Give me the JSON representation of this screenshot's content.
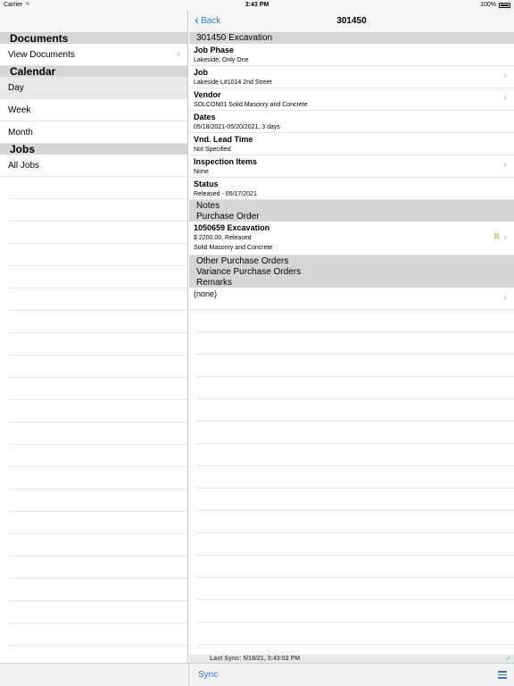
{
  "status_bar": {
    "carrier": "Carrier",
    "time": "3:43 PM",
    "battery": "100%"
  },
  "left_pane": {
    "sections": [
      {
        "header": "Documents",
        "items": [
          "View Documents"
        ]
      },
      {
        "header": "Calendar",
        "items": [
          "Day",
          "Week",
          "Month"
        ]
      },
      {
        "header": "Jobs",
        "items": [
          "All Jobs"
        ]
      }
    ],
    "selected_item": "Day"
  },
  "nav": {
    "back_label": "Back",
    "title": "301450"
  },
  "detail": {
    "section_title": "301450 Excavation",
    "fields": [
      {
        "label": "Job Phase",
        "value": "Lakeside, Only One"
      },
      {
        "label": "Job",
        "value": "Lakeside L#1014 2nd Street"
      },
      {
        "label": "Vendor",
        "value": "SOLCON01 Solid Masonry and Concrete"
      },
      {
        "label": "Dates",
        "value": "05/18/2021-05/20/2021, 3 days"
      },
      {
        "label": "Vnd. Lead Time",
        "value": "Not Specified"
      },
      {
        "label": "Inspection Items",
        "value": "None"
      },
      {
        "label": "Status",
        "value": "Released - 05/17/2021"
      }
    ],
    "notes_header": "Notes",
    "purchase_order_header": "Purchase Order",
    "purchase_order": {
      "title": "1050659 Excavation",
      "line1": "$ 2200.00, Released",
      "line2": "Solid Masonry and Concrete",
      "badge": "R"
    },
    "other_headers": [
      "Other Purchase Orders",
      "Variance Purchase Orders",
      "Remarks"
    ],
    "remarks_value": "(none)"
  },
  "sync": {
    "last_sync": "Last Sync: 5/18/21, 3:43:02 PM",
    "button_label": "Sync"
  },
  "colors": {
    "accent": "#1a7cf5",
    "header_bg": "#d6d6d6",
    "badge": "#8fb83b"
  }
}
